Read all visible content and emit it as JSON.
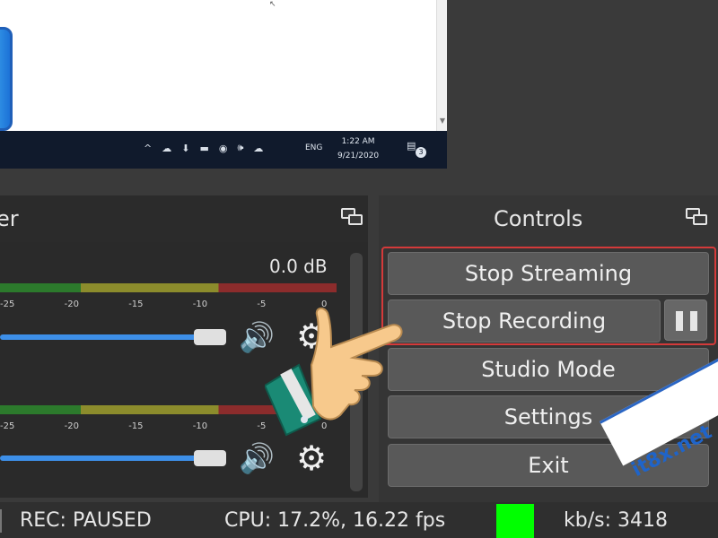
{
  "preview": {
    "taskbar": {
      "tray_icons": [
        "chevron-up-icon",
        "cloud-error-icon",
        "usb-icon",
        "battery-icon",
        "wifi-icon",
        "volume-icon",
        "onedrive-icon"
      ],
      "tray_glyphs": [
        "^",
        "☁",
        "⬇",
        "▬",
        "◉",
        "🕪",
        "☁"
      ],
      "language": "ENG",
      "time": "1:22 AM",
      "date": "9/21/2020",
      "notification_count": "3"
    }
  },
  "mixer": {
    "title_fragment": "er",
    "db_readout": "0.0 dB",
    "tick_labels": [
      "-25",
      "-20",
      "-15",
      "-10",
      "-5",
      "0"
    ]
  },
  "controls": {
    "title": "Controls",
    "stop_streaming": "Stop Streaming",
    "stop_recording": "Stop Recording",
    "studio_mode": "Studio Mode",
    "settings": "Settings",
    "exit": "Exit"
  },
  "statusbar": {
    "rec": "REC: PAUSED",
    "cpu": "CPU: 17.2%, 16.22 fps",
    "kbs": "kb/s: 3418",
    "indicator_color": "#00ff00"
  },
  "watermark": "it8x.net",
  "colors": {
    "highlight_border": "#d43a3a",
    "volume_slider": "#3d8fe8",
    "watermark_blue": "#1f64c9"
  }
}
